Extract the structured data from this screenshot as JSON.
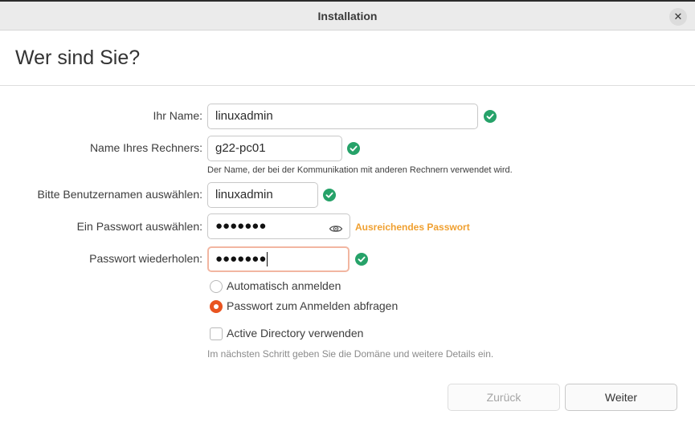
{
  "window": {
    "title": "Installation"
  },
  "page": {
    "heading": "Wer sind Sie?"
  },
  "form": {
    "name": {
      "label": "Ihr Name:",
      "value": "linuxadmin"
    },
    "computer": {
      "label": "Name Ihres Rechners:",
      "value": "g22-pc01",
      "hint": "Der Name, der bei der Kommunikation mit anderen Rechnern verwendet wird."
    },
    "username": {
      "label": "Bitte Benutzernamen auswählen:",
      "value": "linuxadmin"
    },
    "password": {
      "label": "Ein Passwort auswählen:",
      "masked": "●●●●●●●",
      "strength": "Ausreichendes Passwort"
    },
    "confirm": {
      "label": "Passwort wiederholen:",
      "masked": "●●●●●●●"
    }
  },
  "login_options": [
    {
      "label": "Automatisch anmelden",
      "selected": false
    },
    {
      "label": "Passwort zum Anmelden abfragen",
      "selected": true
    }
  ],
  "active_directory": {
    "label": "Active Directory verwenden",
    "checked": false,
    "hint": "Im nächsten Schritt geben Sie die Domäne und weitere Details ein."
  },
  "buttons": {
    "back": "Zurück",
    "next": "Weiter"
  },
  "colors": {
    "accent": "#e95420",
    "valid": "#26a269",
    "warning": "#f0a030"
  },
  "icons": {
    "close": "close-icon",
    "valid": "checkmark-icon",
    "reveal": "eye-icon"
  }
}
